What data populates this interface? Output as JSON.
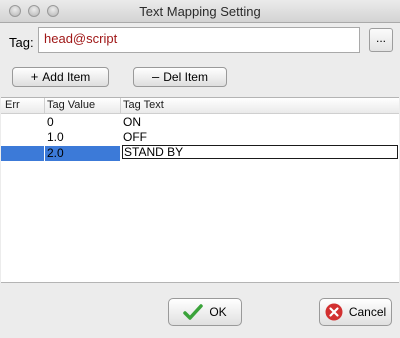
{
  "window": {
    "title": "Text Mapping Setting"
  },
  "tag": {
    "label": "Tag:",
    "value": "head@script",
    "browse_label": "..."
  },
  "toolbar": {
    "add_label": "Add Item",
    "add_symbol": "+",
    "del_label": "Del Item",
    "del_symbol": "–"
  },
  "table": {
    "headers": [
      "Err",
      "Tag Value",
      "Tag Text"
    ],
    "rows": [
      {
        "err": "",
        "value": "0",
        "text": "ON"
      },
      {
        "err": "",
        "value": "1.0",
        "text": "OFF"
      },
      {
        "err": "",
        "value": "2.0",
        "text": "STAND BY",
        "selected": true
      }
    ]
  },
  "footer": {
    "ok_label": "OK",
    "cancel_label": "Cancel"
  },
  "icons": [
    "close-window-icon",
    "minimize-window-icon",
    "zoom-window-icon",
    "check-icon",
    "cancel-icon"
  ],
  "colors": {
    "tag_text": "#a01818",
    "selection": "#3c7ad8",
    "ok_icon": "#3aa33a",
    "cancel_icon": "#d23030"
  }
}
